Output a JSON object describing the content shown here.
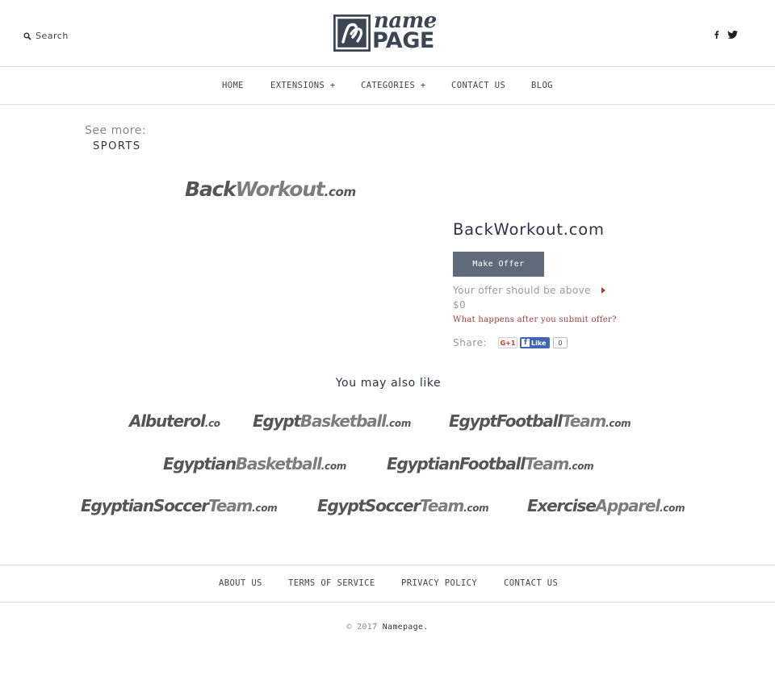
{
  "header": {
    "search_label": "Search",
    "logo": {
      "name": "name",
      "page": "PAGE",
      "mark": "n"
    }
  },
  "nav": [
    {
      "label": "HOME"
    },
    {
      "label": "EXTENSIONS +"
    },
    {
      "label": "CATEGORIES +"
    },
    {
      "label": "CONTACT US"
    },
    {
      "label": "BLOG"
    }
  ],
  "sidebar": {
    "see_more": "See more:",
    "category": "SPORTS"
  },
  "listing": {
    "logo": {
      "dark": "Back",
      "light": "Workout",
      "tld": ".com"
    },
    "domain": "BackWorkout.com",
    "offer_button": "Make Offer",
    "offer_note": "Your offer should be above",
    "offer_amount": "$0",
    "what_happens": "What happens after you submit offer?",
    "share_label": "Share:",
    "gplus_label": "G+1",
    "fb_like_label": "Like",
    "like_count": "0"
  },
  "also_like": {
    "heading": "You may also like",
    "items": [
      {
        "dark": "Albuterol",
        "light": "",
        "tld": ".co"
      },
      {
        "dark": "Egypt",
        "light": "Basketball",
        "tld": ".com"
      },
      {
        "dark": "EgyptFootball",
        "light": "Team",
        "tld": ".com"
      },
      {
        "dark": "Egyptian",
        "light": "Basketball",
        "tld": ".com"
      },
      {
        "dark": "EgyptianFootball",
        "light": "Team",
        "tld": ".com"
      },
      {
        "dark": "EgyptianSoccer",
        "light": "Team",
        "tld": ".com"
      },
      {
        "dark": "EgyptSoccer",
        "light": "Team",
        "tld": ".com"
      },
      {
        "dark": "Exercise",
        "light": "Apparel",
        "tld": ".com"
      }
    ]
  },
  "footer": {
    "links": [
      {
        "label": "ABOUT US"
      },
      {
        "label": "TERMS OF SERVICE"
      },
      {
        "label": "PRIVACY POLICY"
      },
      {
        "label": "CONTACT US"
      }
    ],
    "copyright": "© 2017",
    "brand": "Namepage."
  },
  "colors": {
    "accent_dark": "#2b3447",
    "button": "#606b7a",
    "link_red": "#a33a3a",
    "facebook": "#4267b2"
  },
  "icons": [
    "search-icon",
    "facebook-icon",
    "twitter-icon",
    "caret-right-icon"
  ]
}
